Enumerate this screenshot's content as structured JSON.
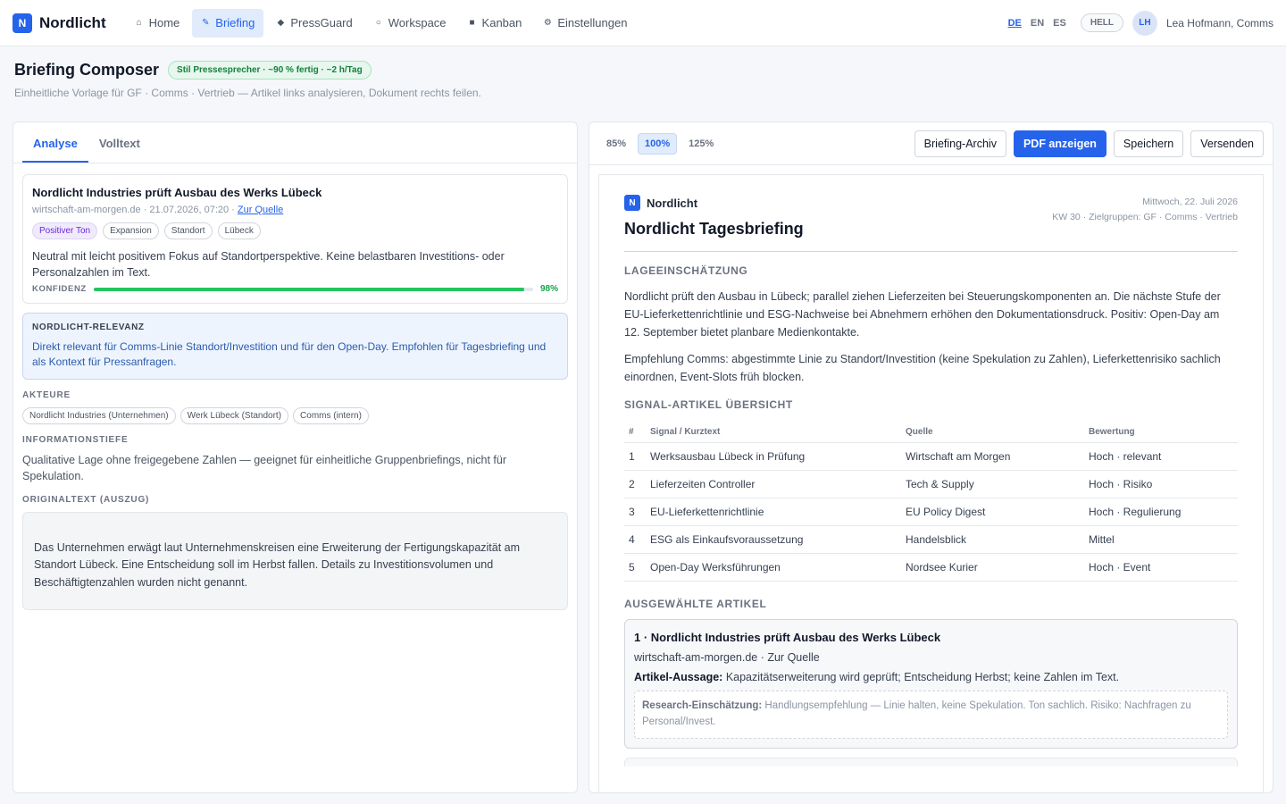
{
  "app": {
    "brand": "Nordlicht",
    "logo_letter": "N",
    "nav": [
      {
        "label": "Home",
        "icon": "home-icon"
      },
      {
        "label": "Briefing",
        "icon": "pen-icon"
      },
      {
        "label": "PressGuard",
        "icon": "diamond-icon"
      },
      {
        "label": "Workspace",
        "icon": "circle-icon"
      },
      {
        "label": "Kanban",
        "icon": "square-icon"
      },
      {
        "label": "Einstellungen",
        "icon": "gear-icon"
      }
    ],
    "active_nav": "Briefing",
    "langs": [
      "DE",
      "EN",
      "ES"
    ],
    "active_lang": "DE",
    "theme": "HELL",
    "user_initials": "LH",
    "user_name": "Lea Hofmann, Comms"
  },
  "header": {
    "title": "Briefing Composer",
    "badge": "Stil Pressesprecher · ~90 % fertig · ~2 h/Tag",
    "subtitle": "Einheitliche Vorlage für GF · Comms · Vertrieb — Artikel links analysieren, Dokument rechts feilen."
  },
  "left": {
    "tabs": [
      "Analyse",
      "Volltext"
    ],
    "active_tab": "Analyse",
    "article": {
      "title": "Nordlicht Industries prüft Ausbau des Werks Lübeck",
      "meta": "wirtschaft-am-morgen.de · 21.07.2026, 07:20 · ",
      "source_link": "Zur Quelle",
      "tags": [
        "Positiver Ton",
        "Expansion",
        "Standort",
        "Lübeck"
      ],
      "summary": "Neutral mit leicht positivem Fokus auf Standortperspektive. Keine belastbaren Investitions- oder Personalzahlen im Text.",
      "confidence_label": "KONFIDENZ",
      "confidence": 0.98,
      "confidence_text": "98%"
    },
    "relevance": {
      "title": "NORDLICHT-RELEVANZ",
      "text": "Direkt relevant für Comms-Linie Standort/Investition und für den Open-Day. Empfohlen für Tagesbriefing und als Kontext für Pressanfragen."
    },
    "actors": {
      "label": "AKTEURE",
      "items": [
        "Nordlicht Industries (Unternehmen)",
        "Werk Lübeck (Standort)",
        "Comms (intern)"
      ]
    },
    "depth": {
      "label": "INFORMATIONSTIEFE",
      "text": "Qualitative Lage ohne freigegebene Zahlen — geeignet für einheitliche Gruppenbriefings, nicht für Spekulation."
    },
    "original": {
      "label": "ORIGINALTEXT (AUSZUG)",
      "text": "Das Unternehmen erwägt laut Unternehmenskreisen eine Erweiterung der Fertigungskapazität am Standort Lübeck. Eine Entscheidung soll im Herbst fallen. Details zu Investitionsvolumen und Beschäftigtenzahlen wurden nicht genannt."
    }
  },
  "right": {
    "zooms": [
      "85%",
      "100%",
      "125%"
    ],
    "active_zoom": "100%",
    "buttons": {
      "archive": "Briefing-Archiv",
      "pdf": "PDF anzeigen",
      "save": "Speichern",
      "send": "Versenden"
    },
    "doc": {
      "brand": "Nordlicht",
      "title": "Nordlicht Tagesbriefing",
      "date": "Mittwoch, 22. Juli 2026",
      "meta": "KW 30 · Zielgruppen: GF · Comms · Vertrieb",
      "section_situation": "LAGEEINSCHÄTZUNG",
      "para1": "Nordlicht prüft den Ausbau in Lübeck; parallel ziehen Lieferzeiten bei Steuerungskomponenten an. Die nächste Stufe der EU-Lieferkettenrichtlinie und ESG-Nachweise bei Abnehmern erhöhen den Dokumentationsdruck. Positiv: Open-Day am 12. September bietet planbare Medienkontakte.",
      "para2": "Empfehlung Comms: abgestimmte Linie zu Standort/Investition (keine Spekulation zu Zahlen), Lieferkettenrisiko sachlich einordnen, Event-Slots früh blocken.",
      "section_signals": "SIGNAL-ARTIKEL ÜBERSICHT",
      "table_headers": [
        "#",
        "Signal / Kurztext",
        "Quelle",
        "Bewertung"
      ],
      "rows": [
        {
          "n": "1",
          "signal": "Werksausbau Lübeck in Prüfung",
          "source": "Wirtschaft am Morgen",
          "rating": "Hoch · relevant"
        },
        {
          "n": "2",
          "signal": "Lieferzeiten Controller",
          "source": "Tech & Supply",
          "rating": "Hoch · Risiko"
        },
        {
          "n": "3",
          "signal": "EU-Lieferkettenrichtlinie",
          "source": "EU Policy Digest",
          "rating": "Hoch · Regulierung"
        },
        {
          "n": "4",
          "signal": "ESG als Einkaufsvoraussetzung",
          "source": "Handelsblick",
          "rating": "Mittel"
        },
        {
          "n": "5",
          "signal": "Open-Day Werksführungen",
          "source": "Nordsee Kurier",
          "rating": "Hoch · Event"
        }
      ],
      "section_selected": "AUSGEWÄHLTE ARTIKEL",
      "selected": {
        "title": "1 · Nordlicht Industries prüft Ausbau des Werks Lübeck",
        "source": "wirtschaft-am-morgen.de · Zur Quelle",
        "claim_label": "Artikel-Aussage:",
        "claim": " Kapazitätserweiterung wird geprüft; Entscheidung Herbst; keine Zahlen im Text.",
        "research_label": "Research-Einschätzung:",
        "research": " Handlungsempfehlung — Linie halten, keine Spekulation. Ton sachlich. Risiko: Nachfragen zu Personal/Invest."
      }
    }
  },
  "colors": {
    "accent": "#2563eb",
    "success": "#22c55e",
    "badge_green": "#15803d"
  }
}
